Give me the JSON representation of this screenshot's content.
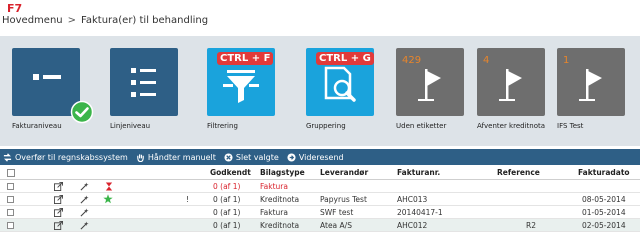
{
  "shortcut": "F7",
  "breadcrumb": {
    "home": "Hovedmenu",
    "separator": ">",
    "current": "Faktura(er) til behandling"
  },
  "tiles": [
    {
      "label": "Fakturaniveau",
      "icon": "invoice-level-icon",
      "badge": "check-icon"
    },
    {
      "label": "Linjeniveau",
      "icon": "line-level-icon"
    },
    {
      "label": "Filtrering",
      "icon": "filter-icon",
      "shortcut": "CTRL + F"
    },
    {
      "label": "Gruppering",
      "icon": "grouping-icon",
      "shortcut": "CTRL + G"
    },
    {
      "label": "Uden etiketter",
      "icon": "flag-icon",
      "count": "429"
    },
    {
      "label": "Afventer kreditnota",
      "icon": "flag-icon",
      "count": "4"
    },
    {
      "label": "IFS Test",
      "icon": "flag-icon",
      "count": "1"
    }
  ],
  "actions": [
    {
      "label": "Overfør til regnskabssystem",
      "icon": "transfer-icon"
    },
    {
      "label": "Håndter manuelt",
      "icon": "hand-icon"
    },
    {
      "label": "Slet valgte",
      "icon": "delete-icon"
    },
    {
      "label": "Videresend",
      "icon": "forward-icon"
    }
  ],
  "table": {
    "columns": [
      "Godkendt",
      "Bilagstype",
      "Leverandør",
      "Fakturanr.",
      "Reference",
      "Fakturadato"
    ],
    "rows": [
      {
        "flag": "",
        "approved": "0 (af 1)",
        "type": "Faktura",
        "supplier": "",
        "invoice_no": "",
        "reference": "",
        "date": "",
        "red": true,
        "hourglass": true,
        "star": false
      },
      {
        "flag": "!",
        "approved": "0 (af 1)",
        "type": "Kreditnota",
        "supplier": "Papyrus Test",
        "invoice_no": "AHC013",
        "reference": "",
        "date": "08-05-2014",
        "red": false,
        "hourglass": false,
        "star": true
      },
      {
        "flag": "",
        "approved": "0 (af 1)",
        "type": "Faktura",
        "supplier": "SWF test",
        "invoice_no": "20140417-1",
        "reference": "",
        "date": "01-05-2014",
        "red": false,
        "hourglass": false,
        "star": false
      },
      {
        "flag": "",
        "approved": "0 (af 1)",
        "type": "Kreditnota",
        "supplier": "Atea A/S",
        "invoice_no": "AHC012",
        "reference": "R2",
        "date": "02-05-2014",
        "red": false,
        "hourglass": false,
        "star": false
      }
    ]
  },
  "colors": {
    "accent": "#2e5f86",
    "cyan": "#1aa3dc",
    "gray_tile": "#6e6e6e",
    "red": "#d9232d",
    "count": "#e8852b",
    "check": "#3bb54a"
  }
}
